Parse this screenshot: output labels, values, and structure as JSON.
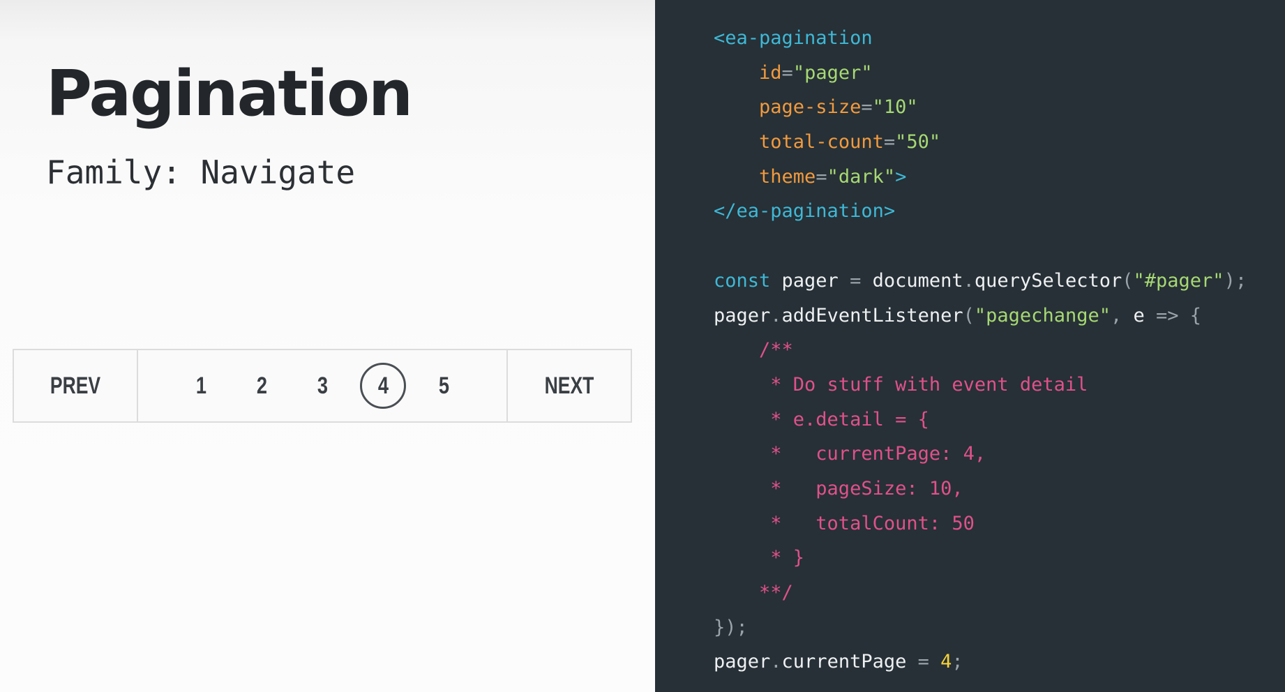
{
  "slide": {
    "title": "Pagination",
    "subtitle": "Family: Navigate"
  },
  "pagination": {
    "prev_label": "PREV",
    "next_label": "NEXT",
    "pages": [
      "1",
      "2",
      "3",
      "4",
      "5"
    ],
    "current_page": "4"
  },
  "code": {
    "lines": [
      [
        {
          "t": "<ea-pagination",
          "c": "tag"
        }
      ],
      [
        {
          "t": "    ",
          "c": "id"
        },
        {
          "t": "id",
          "c": "attr"
        },
        {
          "t": "=",
          "c": "punct"
        },
        {
          "t": "\"pager\"",
          "c": "str"
        }
      ],
      [
        {
          "t": "    ",
          "c": "id"
        },
        {
          "t": "page-size",
          "c": "attr"
        },
        {
          "t": "=",
          "c": "punct"
        },
        {
          "t": "\"10\"",
          "c": "str"
        }
      ],
      [
        {
          "t": "    ",
          "c": "id"
        },
        {
          "t": "total-count",
          "c": "attr"
        },
        {
          "t": "=",
          "c": "punct"
        },
        {
          "t": "\"50\"",
          "c": "str"
        }
      ],
      [
        {
          "t": "    ",
          "c": "id"
        },
        {
          "t": "theme",
          "c": "attr"
        },
        {
          "t": "=",
          "c": "punct"
        },
        {
          "t": "\"dark\"",
          "c": "str"
        },
        {
          "t": ">",
          "c": "tag"
        }
      ],
      [
        {
          "t": "</ea-pagination>",
          "c": "tag"
        }
      ],
      [],
      [
        {
          "t": "const",
          "c": "kw"
        },
        {
          "t": " pager ",
          "c": "id"
        },
        {
          "t": "=",
          "c": "punct"
        },
        {
          "t": " document",
          "c": "id"
        },
        {
          "t": ".",
          "c": "punct"
        },
        {
          "t": "querySelector",
          "c": "id"
        },
        {
          "t": "(",
          "c": "punct"
        },
        {
          "t": "\"#pager\"",
          "c": "str"
        },
        {
          "t": ");",
          "c": "punct"
        }
      ],
      [
        {
          "t": "pager",
          "c": "id"
        },
        {
          "t": ".",
          "c": "punct"
        },
        {
          "t": "addEventListener",
          "c": "id"
        },
        {
          "t": "(",
          "c": "punct"
        },
        {
          "t": "\"pagechange\"",
          "c": "str"
        },
        {
          "t": ", ",
          "c": "punct"
        },
        {
          "t": "e ",
          "c": "id"
        },
        {
          "t": "=>",
          "c": "punct"
        },
        {
          "t": " {",
          "c": "punct"
        }
      ],
      [
        {
          "t": "    /**",
          "c": "cmt"
        }
      ],
      [
        {
          "t": "     * Do stuff with event detail",
          "c": "cmt"
        }
      ],
      [
        {
          "t": "     * e.detail = {",
          "c": "cmt"
        }
      ],
      [
        {
          "t": "     *   currentPage: 4,",
          "c": "cmt"
        }
      ],
      [
        {
          "t": "     *   pageSize: 10,",
          "c": "cmt"
        }
      ],
      [
        {
          "t": "     *   totalCount: 50",
          "c": "cmt"
        }
      ],
      [
        {
          "t": "     * }",
          "c": "cmt"
        }
      ],
      [
        {
          "t": "    **/",
          "c": "cmt"
        }
      ],
      [
        {
          "t": "});",
          "c": "punct"
        }
      ],
      [
        {
          "t": "pager",
          "c": "id"
        },
        {
          "t": ".",
          "c": "punct"
        },
        {
          "t": "currentPage ",
          "c": "id"
        },
        {
          "t": "=",
          "c": "punct"
        },
        {
          "t": " 4",
          "c": "num"
        },
        {
          "t": ";",
          "c": "punct"
        }
      ]
    ]
  }
}
